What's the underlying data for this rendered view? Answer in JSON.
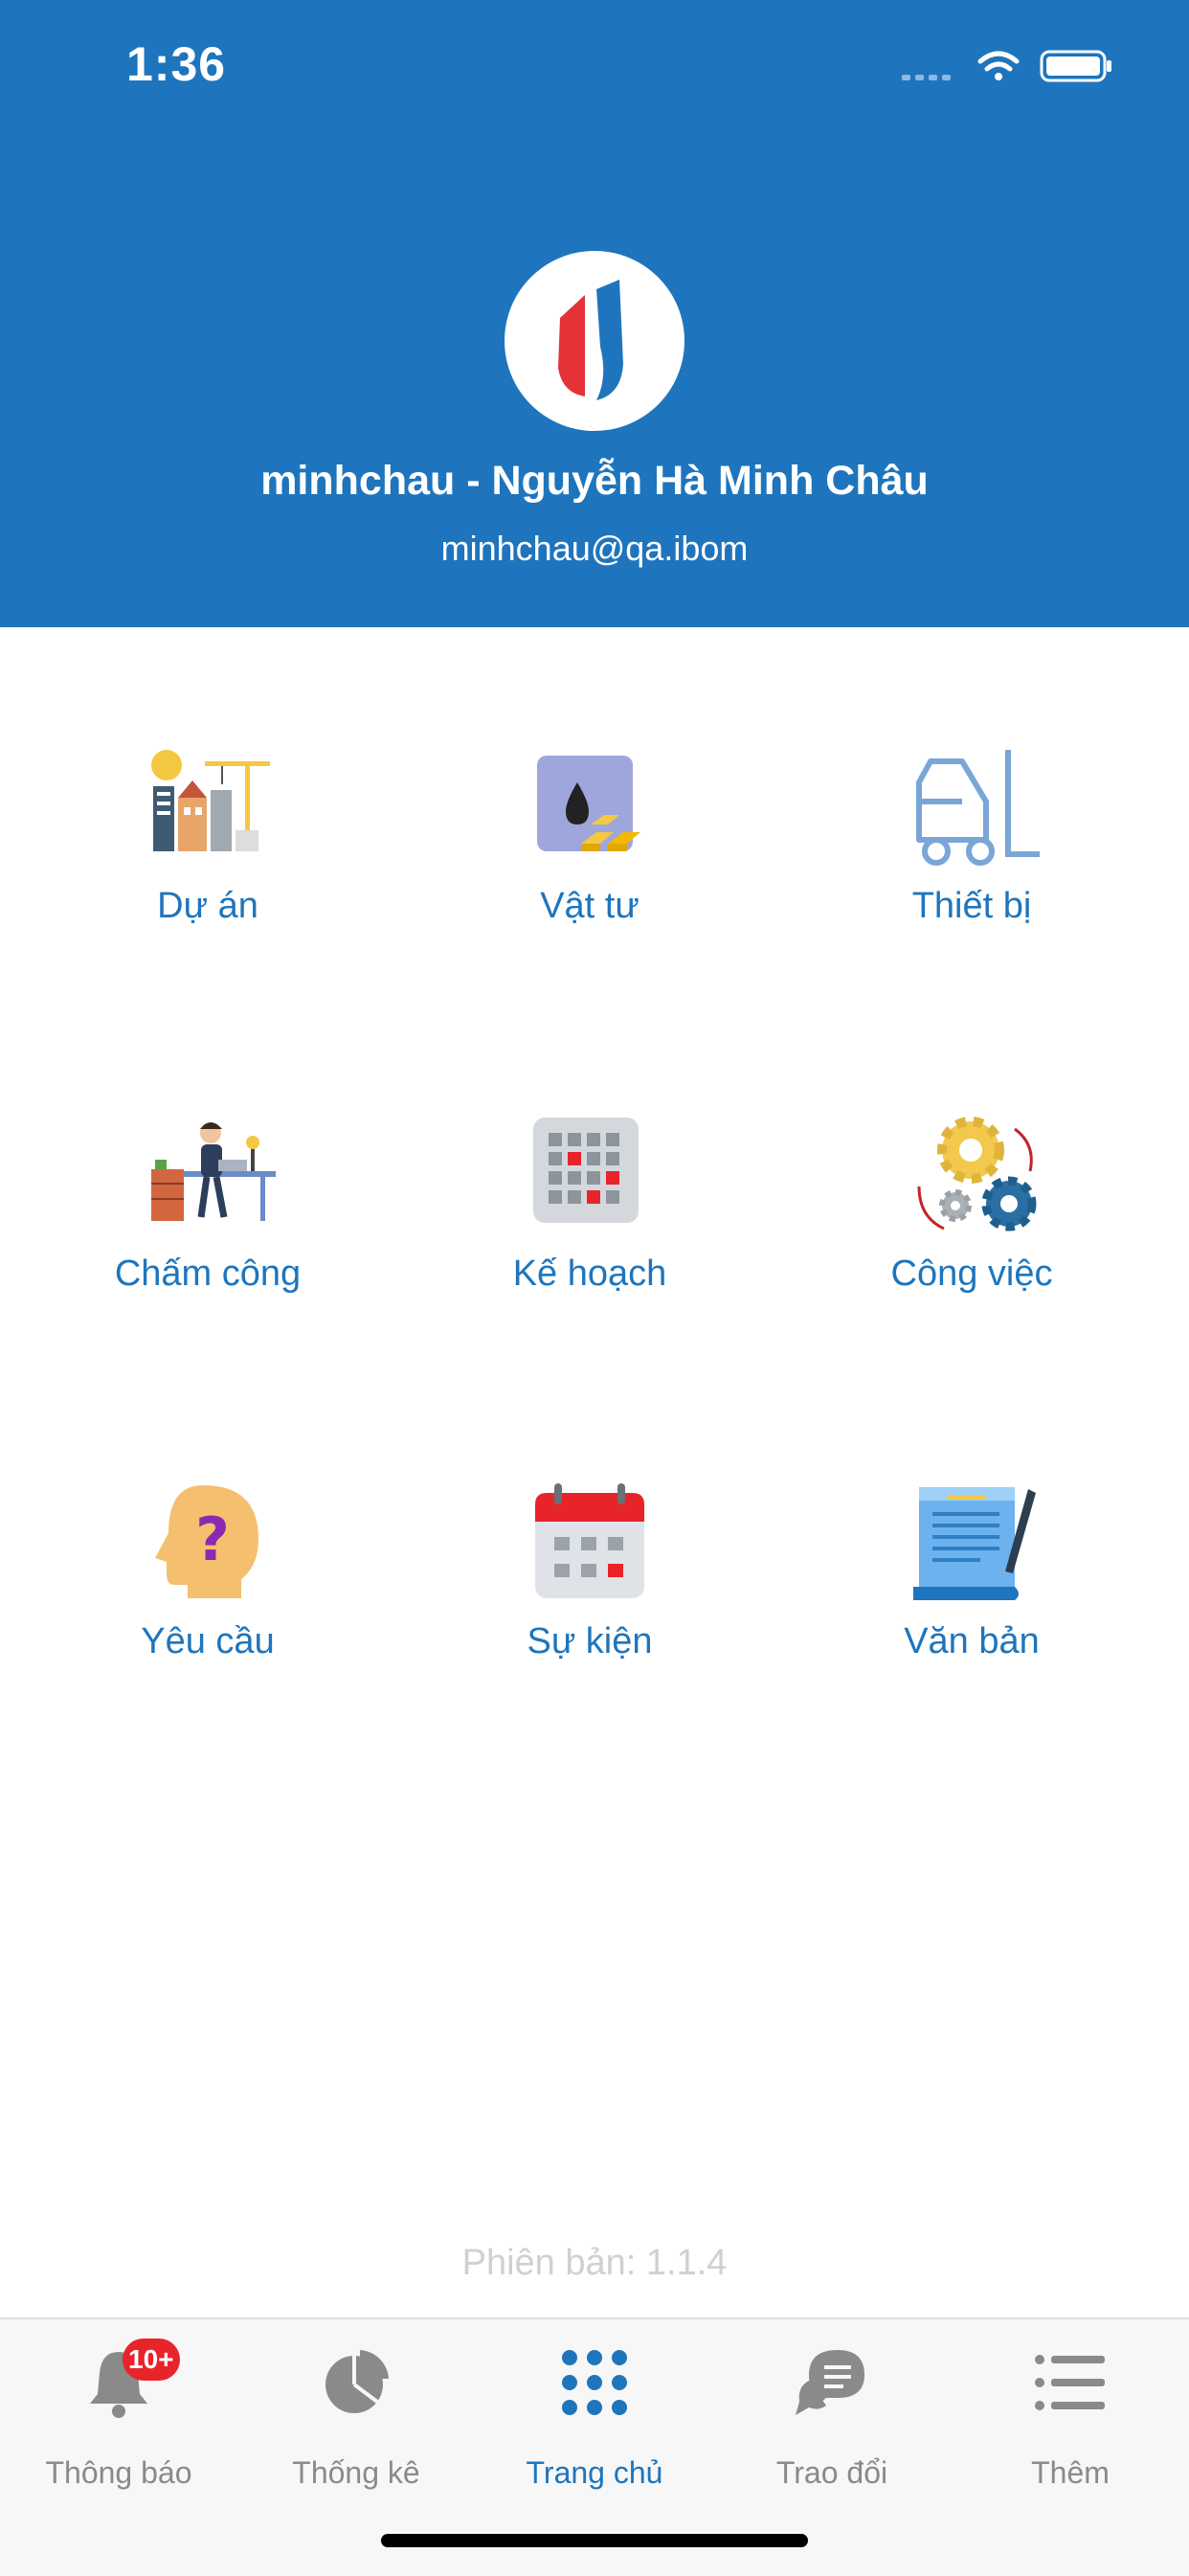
{
  "status_bar": {
    "time": "1:36"
  },
  "profile": {
    "name": "minhchau - Nguyễn Hà Minh Châu",
    "email": "minhchau@qa.ibom"
  },
  "menu": [
    {
      "label": "Dự án",
      "icon": "construction-project-icon"
    },
    {
      "label": "Vật tư",
      "icon": "materials-icon"
    },
    {
      "label": "Thiết bị",
      "icon": "forklift-icon"
    },
    {
      "label": "Chấm công",
      "icon": "timekeeping-icon"
    },
    {
      "label": "Kế hoạch",
      "icon": "plan-grid-icon"
    },
    {
      "label": "Công việc",
      "icon": "gears-icon"
    },
    {
      "label": "Yêu cầu",
      "icon": "question-head-icon"
    },
    {
      "label": "Sự kiện",
      "icon": "calendar-icon"
    },
    {
      "label": "Văn bản",
      "icon": "document-scroll-icon"
    }
  ],
  "version": "Phiên bản: 1.1.4",
  "tabbar": {
    "notifications": {
      "label": "Thông báo",
      "badge": "10+"
    },
    "stats": {
      "label": "Thống kê"
    },
    "home": {
      "label": "Trang chủ"
    },
    "chat": {
      "label": "Trao đổi"
    },
    "more": {
      "label": "Thêm"
    }
  },
  "colors": {
    "primary": "#1e75bd",
    "badge": "#e8242b",
    "tab_inactive": "#8a8a8a",
    "version_text": "#d0d0d0"
  }
}
